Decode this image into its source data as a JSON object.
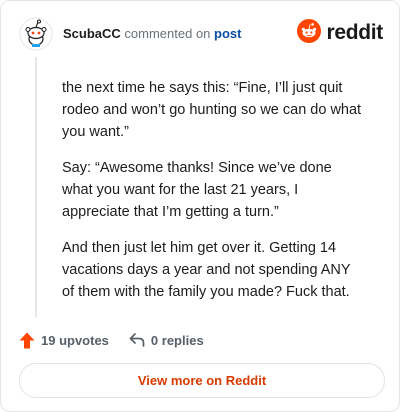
{
  "header": {
    "username": "ScubaCC",
    "commented_on": "commented on",
    "post_link": "post",
    "brand": "reddit",
    "avatar_icon": "snoo-avatar-icon",
    "logo_icon": "reddit-logo-icon"
  },
  "comment": {
    "paragraphs": [
      "the next time he says this: “Fine, I’ll just quit rodeo and won’t go hunting so we can do what you want.”",
      "Say: “Awesome thanks! Since we’ve done what you want for the last 21 years, I appreciate that I’m getting a turn.”",
      "And then just let him get over it. Getting 14 vacations days a year and not spending ANY of them with the family you made? Fuck that."
    ]
  },
  "actions": {
    "upvotes": "19 upvotes",
    "replies": "0 replies",
    "upvote_icon": "upvote-arrow-icon",
    "reply_icon": "reply-arrow-icon"
  },
  "footer": {
    "view_more": "View more on Reddit"
  },
  "colors": {
    "brand_orange": "#ff4500",
    "link_blue": "#0a4fa6",
    "view_more_text": "#d93a00"
  }
}
